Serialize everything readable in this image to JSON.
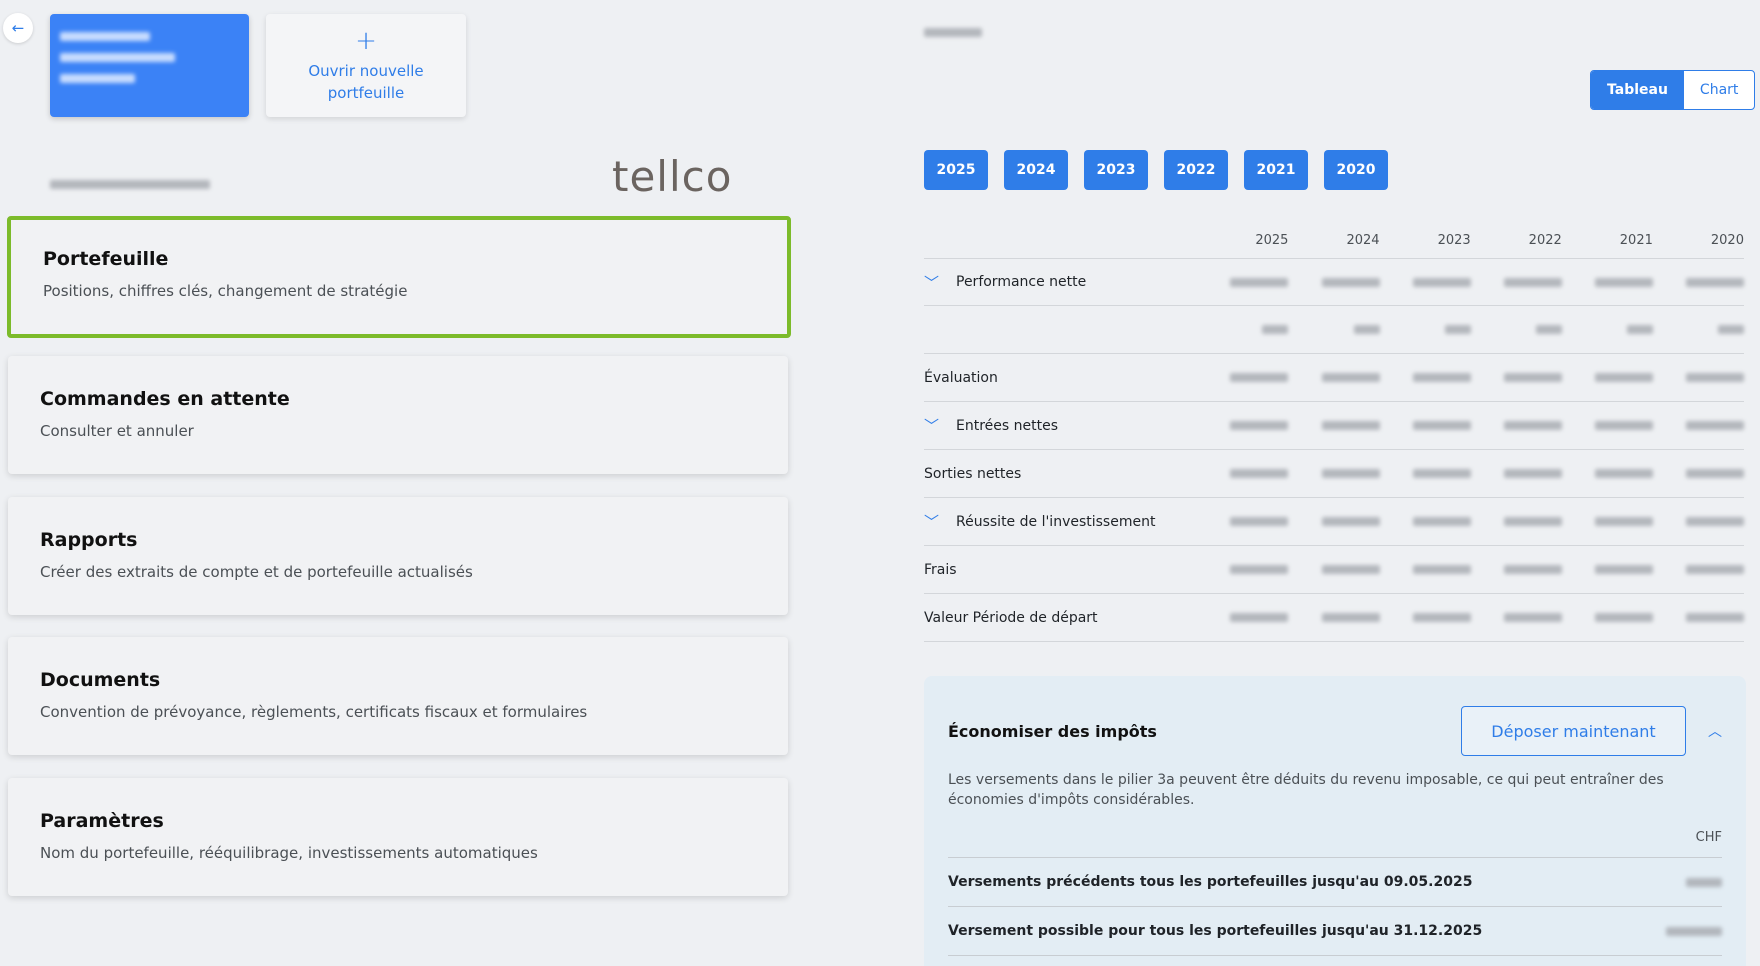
{
  "header": {
    "back_icon": "arrow-left-icon",
    "new_portfolio_label": "Ouvrir nouvelle portfeuille",
    "new_portfolio_icon": "plus-icon",
    "brand_logo": "tellco"
  },
  "menu": [
    {
      "title": "Portefeuille",
      "description": "Positions, chiffres clés, changement de stratégie"
    },
    {
      "title": "Commandes en attente",
      "description": "Consulter et annuler"
    },
    {
      "title": "Rapports",
      "description": "Créer des extraits de compte et de portefeuille actualisés"
    },
    {
      "title": "Documents",
      "description": "Convention de prévoyance, règlements, certificats fiscaux et formulaires"
    },
    {
      "title": "Paramètres",
      "description": "Nom du portefeuille, rééquilibrage, investissements automatiques"
    }
  ],
  "view_toggle": {
    "tableau": "Tableau",
    "chart": "Chart"
  },
  "years": [
    "2025",
    "2024",
    "2023",
    "2022",
    "2021",
    "2020"
  ],
  "table": {
    "rows": [
      {
        "label": "Performance nette",
        "expandable": true
      },
      {
        "label": "",
        "expandable": false
      },
      {
        "label": "Évaluation",
        "expandable": false
      },
      {
        "label": "Entrées nettes",
        "expandable": true
      },
      {
        "label": "Sorties nettes",
        "expandable": false
      },
      {
        "label": "Réussite de l'investissement",
        "expandable": true
      },
      {
        "label": "Frais",
        "expandable": false
      },
      {
        "label": "Valeur Période de départ",
        "expandable": false
      }
    ]
  },
  "tax": {
    "title": "Économiser des impôts",
    "deposit_label": "Déposer maintenant",
    "text": "Les versements dans le pilier 3a peuvent être déduits du revenu imposable, ce qui peut entraîner des économies d'impôts considérables.",
    "unit": "CHF",
    "rows": [
      {
        "label": "Versements précédents tous les portefeuilles jusqu'au 09.05.2025"
      },
      {
        "label": "Versement possible pour tous les portefeuilles jusqu'au 31.12.2025"
      }
    ]
  },
  "colors": {
    "accent": "#2f7de8",
    "selected_border": "#7cbb2a"
  }
}
